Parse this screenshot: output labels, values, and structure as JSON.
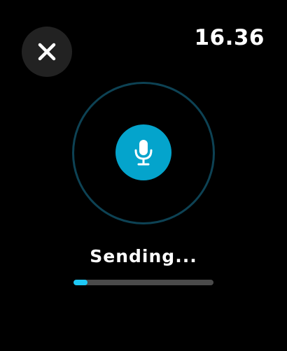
{
  "header": {
    "time": "16.36",
    "close_icon": "close-icon"
  },
  "recorder": {
    "mic_icon": "microphone-icon",
    "accent_color": "#04a4cc",
    "ring_color": "#0d4254"
  },
  "status": {
    "label": "Sending...",
    "progress": 0.1,
    "progress_color": "#1ec8f5"
  }
}
